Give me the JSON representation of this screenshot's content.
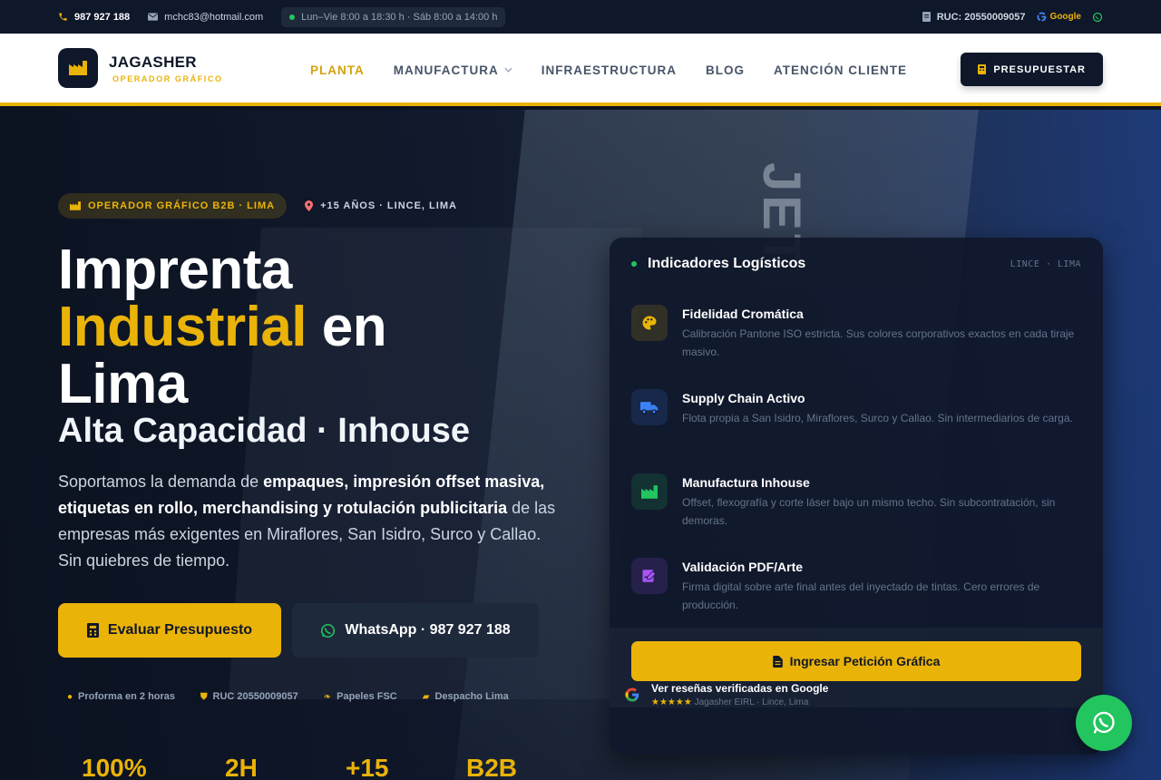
{
  "topbar": {
    "phone": "987 927 188",
    "email": "mchc83@hotmail.com",
    "hours": "Lun–Vie 8:00 a 18:30 h · Sáb 8:00 a 14:00 h",
    "ruc": "RUC: 20550009057",
    "google": "Google"
  },
  "header": {
    "brand": "JAGASHER",
    "brand_sub": "OPERADOR GRÁFICO",
    "nav": [
      "PLANTA",
      "MANUFACTURA",
      "INFRAESTRUCTURA",
      "BLOG",
      "ATENCIÓN CLIENTE"
    ],
    "active_nav": "PLANTA",
    "cta": "PRESUPUESTAR"
  },
  "hero": {
    "badge": "OPERADOR GRÁFICO B2B · LIMA",
    "location": "+15 AÑOS · LINCE, LIMA",
    "title_line1": "Imprenta",
    "title_highlight": "Industrial",
    "title_after": "en",
    "title_line3": "Lima",
    "subtitle": "Alta Capacidad · Inhouse",
    "lead_1": "Soportamos la demanda de ",
    "lead_bold": "empaques, impresión offset masiva, etiquetas en rollo, merchandising y rotulación publicitaria",
    "lead_2": " de las empresas más exigentes en Miraflores, San Isidro, Surco y Callao. Sin quiebres de tiempo.",
    "cta_primary": "Evaluar Presupuesto",
    "cta_secondary": "WhatsApp · 987 927 188",
    "trust": [
      "Proforma en 2 horas",
      "RUC 20550009057",
      "Papeles FSC",
      "Despacho Lima"
    ],
    "stats": [
      "100%",
      "2H",
      "+15",
      "B2B"
    ],
    "bg_sign": "JET"
  },
  "card": {
    "title": "Indicadores Logísticos",
    "loc": "LINCE · LIMA",
    "features": [
      {
        "title": "Fidelidad Cromática",
        "desc": "Calibración Pantone ISO estricta. Sus colores corporativos exactos en cada tiraje masivo.",
        "icon": "palette-icon",
        "color": "#eab308"
      },
      {
        "title": "Supply Chain Activo",
        "desc": "Flota propia a San Isidro, Miraflores, Surco y Callao. Sin intermediarios de carga.",
        "icon": "truck-icon",
        "color": "#3b82f6"
      },
      {
        "title": "Manufactura Inhouse",
        "desc": "Offset, flexografía y corte láser bajo un mismo techo. Sin subcontratación, sin demoras.",
        "icon": "factory-icon",
        "color": "#22c55e"
      },
      {
        "title": "Validación PDF/Arte",
        "desc": "Firma digital sobre arte final antes del inyectado de tintas. Cero errores de producción.",
        "icon": "signature-icon",
        "color": "#a855f7"
      }
    ],
    "button": "Ingresar Petición Gráfica",
    "reviews_title": "Ver reseñas verificadas en Google",
    "reviews_stars": "★★★★★",
    "reviews_sub": "Jagasher EIRL · Lince, Lima"
  },
  "colors": {
    "accent": "#eab308",
    "dark": "#0f172a",
    "whatsapp": "#22c55e"
  }
}
